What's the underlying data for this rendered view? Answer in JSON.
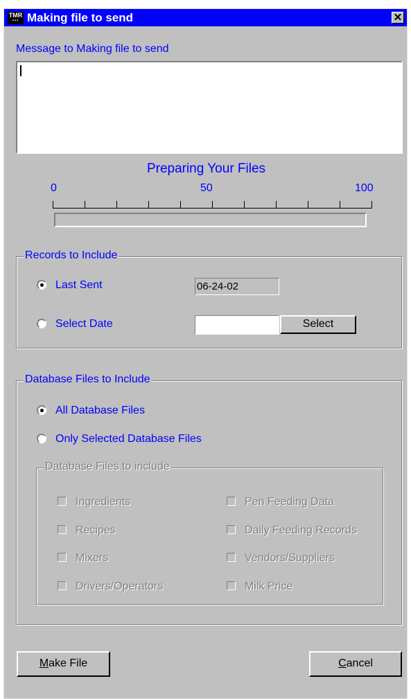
{
  "window": {
    "title": "Making file to send",
    "icon_text_top": "TMR",
    "icon_text_bottom": "▪▪▪",
    "close_glyph": "✕"
  },
  "message": {
    "label": "Message to Making file to send",
    "value": ""
  },
  "progress": {
    "title": "Preparing Your Files",
    "tick_min": "0",
    "tick_mid": "50",
    "tick_max": "100",
    "value_percent": 0
  },
  "records": {
    "group_title": "Records to Include",
    "last_sent_label": "Last Sent",
    "last_sent_value": "06-24-02",
    "select_date_label": "Select Date",
    "select_date_value": "",
    "select_button": "Select",
    "selected_option": "last_sent"
  },
  "database": {
    "group_title": "Database Files to Include",
    "all_label": "All Database Files",
    "only_selected_label": "Only Selected Database Files",
    "selected_option": "all",
    "sub_group_title": "Database Files to include",
    "files": [
      {
        "label": "Ingredients",
        "checked": false
      },
      {
        "label": "Recipes",
        "checked": false
      },
      {
        "label": "Mixers",
        "checked": false
      },
      {
        "label": "Drivers/Operators",
        "checked": false
      },
      {
        "label": "Pen Feeding Data",
        "checked": false
      },
      {
        "label": "Daily Feeding Records",
        "checked": false
      },
      {
        "label": "Vendors/Suppliers",
        "checked": false
      },
      {
        "label": "Milk Price",
        "checked": false
      }
    ]
  },
  "buttons": {
    "make_file_mnemonic": "M",
    "make_file_rest": "ake File",
    "cancel_mnemonic": "C",
    "cancel_rest": "ancel"
  },
  "colors": {
    "title_bar": "#0000fe",
    "label_text": "#0000ff",
    "window_bg": "#c0c0c0"
  }
}
